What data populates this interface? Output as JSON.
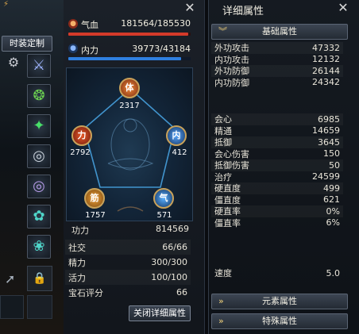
{
  "left": {
    "fashion_button": "时装定制",
    "hp": {
      "label": "气血",
      "value": "181564/185530",
      "ratio": 0.978,
      "color": "#d43a2a"
    },
    "mp": {
      "label": "内力",
      "value": "39773/43184",
      "ratio": 0.921,
      "color": "#2f7fe0"
    },
    "meridian_nodes": [
      {
        "name": "top",
        "glyph": "体",
        "value": "2317",
        "color": "#d9621e"
      },
      {
        "name": "left",
        "glyph": "力",
        "value": "2792",
        "color": "#c9401f"
      },
      {
        "name": "right",
        "glyph": "内",
        "value": "412",
        "color": "#2f7fe0"
      },
      {
        "name": "bottom-left",
        "glyph": "筋",
        "value": "1757",
        "color": "#d98a1e"
      },
      {
        "name": "bottom-right",
        "glyph": "气",
        "value": "571",
        "color": "#3a8fe6"
      }
    ],
    "power": {
      "label": "功力",
      "value": "814569"
    },
    "stats": [
      {
        "label": "社交",
        "value": "66/66"
      },
      {
        "label": "精力",
        "value": "300/300"
      },
      {
        "label": "活力",
        "value": "100/100"
      },
      {
        "label": "宝石评分",
        "value": "66"
      }
    ],
    "close_detail_button": "关闭详细属性"
  },
  "right": {
    "title": "详细属性",
    "base_section": "基础属性",
    "base_rows": [
      {
        "label": "外功攻击",
        "value": "47332"
      },
      {
        "label": "内功攻击",
        "value": "12132"
      },
      {
        "label": "外功防御",
        "value": "26144"
      },
      {
        "label": "内功防御",
        "value": "24342"
      }
    ],
    "combat_rows": [
      {
        "label": "会心",
        "value": "6985"
      },
      {
        "label": "精通",
        "value": "14659"
      },
      {
        "label": "抵御",
        "value": "3645"
      },
      {
        "label": "会心伤害",
        "value": "150"
      },
      {
        "label": "抵御伤害",
        "value": "50"
      },
      {
        "label": "治疗",
        "value": "24599"
      },
      {
        "label": "硬直度",
        "value": "499"
      },
      {
        "label": "僵直度",
        "value": "621"
      },
      {
        "label": "硬直率",
        "value": "0%"
      },
      {
        "label": "僵直率",
        "value": "6%"
      }
    ],
    "speed": {
      "label": "速度",
      "value": "5.0"
    },
    "element_section": "元素属性",
    "special_section": "特殊属性"
  },
  "icons": {
    "close": "close-icon",
    "gear": "gear-icon",
    "lock": "lock-icon"
  }
}
